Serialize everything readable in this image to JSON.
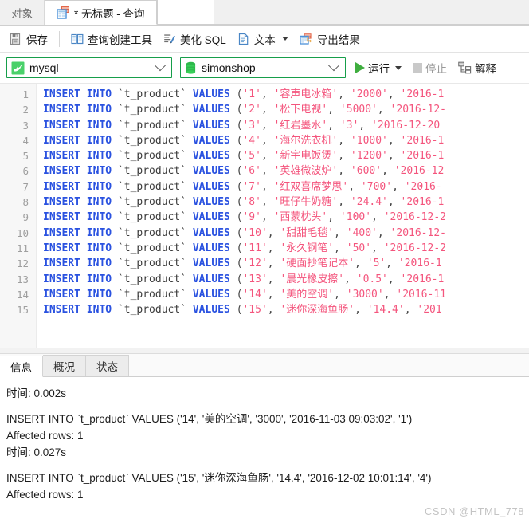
{
  "tabbar": {
    "objects_tab": "对象",
    "query_tab": "* 无标题 - 查询",
    "query_tab_icon": "query-table-icon"
  },
  "toolbar": {
    "save": "保存",
    "query_builder": "查询创建工具",
    "beautify_sql": "美化 SQL",
    "text": "文本",
    "export_result": "导出结果",
    "icons": {
      "save": "save-floppy-icon",
      "query_builder": "query-builder-icon",
      "beautify": "beautify-pencil-icon",
      "text": "text-document-icon",
      "export": "export-table-icon"
    }
  },
  "connbar": {
    "connection_value": "mysql",
    "connection_icon": "mysql-dolphin-icon",
    "database_value": "simonshop",
    "database_icon": "database-cylinder-icon",
    "run": "运行",
    "stop": "停止",
    "explain": "解释",
    "run_icon": "play-triangle-icon",
    "stop_icon": "stop-square-icon",
    "explain_icon": "explain-plan-icon"
  },
  "editor": {
    "line_numbers": [
      "1",
      "2",
      "3",
      "4",
      "5",
      "6",
      "7",
      "8",
      "9",
      "10",
      "11",
      "12",
      "13",
      "14",
      "15"
    ],
    "statement_prefix": "INSERT INTO ",
    "table_name": "`t_product`",
    "values_kw": " VALUES ",
    "rows": [
      {
        "id": "1",
        "name": "容声电冰箱",
        "price": "2000",
        "date": "2016-1"
      },
      {
        "id": "2",
        "name": "松下电视",
        "price": "5000",
        "date": "2016-12-"
      },
      {
        "id": "3",
        "name": "红岩墨水",
        "price": "3",
        "date": "2016-12-20"
      },
      {
        "id": "4",
        "name": "海尔洗衣机",
        "price": "1000",
        "date": "2016-1"
      },
      {
        "id": "5",
        "name": "新宇电饭煲",
        "price": "1200",
        "date": "2016-1"
      },
      {
        "id": "6",
        "name": "英雄微波炉",
        "price": "600",
        "date": "2016-12"
      },
      {
        "id": "7",
        "name": "红双喜席梦思",
        "price": "700",
        "date": "2016-"
      },
      {
        "id": "8",
        "name": "旺仔牛奶糖",
        "price": "24.4",
        "date": "2016-1"
      },
      {
        "id": "9",
        "name": "西蒙枕头",
        "price": "100",
        "date": "2016-12-2"
      },
      {
        "id": "10",
        "name": "甜甜毛毯",
        "price": "400",
        "date": "2016-12-"
      },
      {
        "id": "11",
        "name": "永久钢笔",
        "price": "50",
        "date": "2016-12-2"
      },
      {
        "id": "12",
        "name": "硬面抄笔记本",
        "price": "5",
        "date": "2016-1"
      },
      {
        "id": "13",
        "name": "晨光橡皮擦",
        "price": "0.5",
        "date": "2016-1"
      },
      {
        "id": "14",
        "name": "美的空调",
        "price": "3000",
        "date": "2016-11"
      },
      {
        "id": "15",
        "name": "迷你深海鱼肠",
        "price": "14.4",
        "date": "201"
      }
    ]
  },
  "result": {
    "tabs": [
      {
        "label": "信息",
        "active": true
      },
      {
        "label": "概况",
        "active": false
      },
      {
        "label": "状态",
        "active": false
      }
    ],
    "lines": [
      "时间: 0.002s",
      "",
      "INSERT INTO `t_product` VALUES ('14', '美的空调', '3000', '2016-11-03 09:03:02', '1')",
      "Affected rows: 1",
      "时间: 0.027s",
      "",
      "INSERT INTO `t_product` VALUES ('15', '迷你深海鱼肠', '14.4', '2016-12-02 10:01:14', '4')",
      "Affected rows: 1"
    ],
    "watermark": "CSDN @HTML_778"
  },
  "colors": {
    "keyword_blue": "#2a52e0",
    "string_pink": "#f4557d",
    "accent_green": "#169e4a",
    "run_green": "#3fae3f"
  }
}
